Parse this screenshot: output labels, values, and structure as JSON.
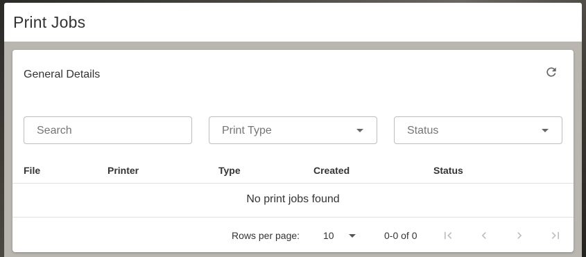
{
  "header": {
    "title": "Print Jobs"
  },
  "card": {
    "title": "General Details",
    "refresh_icon": "refresh-icon"
  },
  "filters": {
    "search_placeholder": "Search",
    "print_type_label": "Print Type",
    "status_label": "Status"
  },
  "table": {
    "columns": [
      "File",
      "Printer",
      "Type",
      "Created",
      "Status"
    ],
    "rows": [],
    "empty_message": "No print jobs found"
  },
  "pagination": {
    "rows_per_page_label": "Rows per page:",
    "rows_per_page_value": "10",
    "range_text": "0-0 of 0",
    "icons": [
      "first-page-icon",
      "previous-page-icon",
      "next-page-icon",
      "last-page-icon"
    ]
  },
  "colors": {
    "header_bg": "#ffffff",
    "text": "#333333",
    "icon": "#666666",
    "disabled_icon": "#bdbdbd"
  }
}
